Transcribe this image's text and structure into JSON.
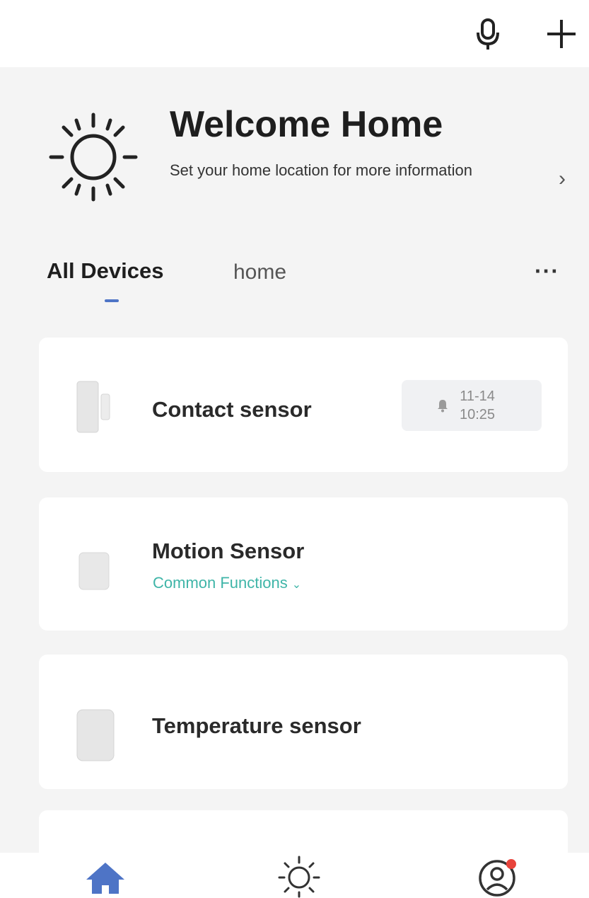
{
  "header": {
    "mic_icon": "microphone-icon",
    "add_icon": "plus-icon"
  },
  "welcome": {
    "title": "Welcome Home",
    "subtitle": "Set your home location for more information",
    "chevron": "›",
    "icon": "sun-icon"
  },
  "tabs": {
    "items": [
      {
        "label": "All Devices",
        "active": true
      },
      {
        "label": "home",
        "active": false
      }
    ],
    "more_label": "···",
    "accent": "#4e74c6"
  },
  "devices": [
    {
      "name": "Contact sensor",
      "icon": "contact-sensor-icon",
      "badge": {
        "date": "11-14",
        "time": "10:25",
        "icon": "bell-icon"
      }
    },
    {
      "name": "Motion Sensor",
      "icon": "motion-sensor-icon",
      "link": "Common Functions",
      "link_color": "#3fb5a8"
    },
    {
      "name": "Temperature sensor",
      "icon": "temperature-sensor-icon"
    }
  ],
  "bottom_nav": {
    "items": [
      {
        "icon": "home-icon",
        "active": true
      },
      {
        "icon": "sun-icon",
        "active": false
      },
      {
        "icon": "profile-icon",
        "active": false,
        "notification_dot": true
      }
    ],
    "active_color": "#4e74c6",
    "dot_color": "#e8433b"
  }
}
